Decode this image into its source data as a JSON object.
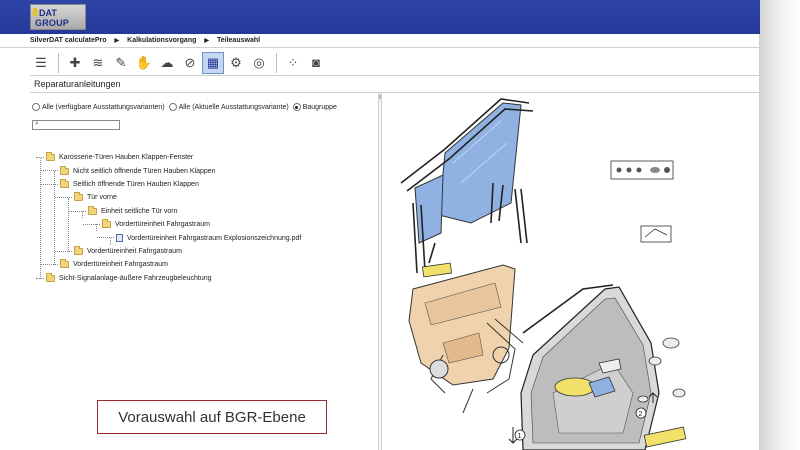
{
  "header": {
    "logo_line1": "DAT",
    "logo_line2": "GROUP"
  },
  "breadcrumb": {
    "items": [
      "SilverDAT calculatePro",
      "Kalkulationsvorgang",
      "Teileauswahl"
    ]
  },
  "toolbar": {
    "buttons": [
      {
        "icon": "menu-icon",
        "glyph": "☰"
      },
      {
        "icon": "add-tool-icon",
        "glyph": "✚"
      },
      {
        "icon": "list-filter-icon",
        "glyph": "≋"
      },
      {
        "icon": "wrench-icon",
        "glyph": "✎"
      },
      {
        "icon": "hand-icon",
        "glyph": "✋"
      },
      {
        "icon": "cloud-icon",
        "glyph": "☁"
      },
      {
        "icon": "no-car-icon",
        "glyph": "⊘"
      },
      {
        "icon": "diagram-icon",
        "glyph": "▦",
        "active": true
      },
      {
        "icon": "engine-icon",
        "glyph": "⚙"
      },
      {
        "icon": "tire-icon",
        "glyph": "◎"
      },
      {
        "icon": "parts-grid-icon",
        "glyph": "⁘"
      },
      {
        "icon": "camera-icon",
        "glyph": "◙"
      }
    ],
    "active_color": "#c6d7ef"
  },
  "section": {
    "title": "Reparaturanleitungen"
  },
  "filter": {
    "options": [
      {
        "label": "Alle (verfügbare Ausstattungsvarianten)",
        "checked": false
      },
      {
        "label": "Alle (Aktuelle Ausstattungsvariante)",
        "checked": false
      },
      {
        "label": "Baugruppe",
        "checked": true
      }
    ],
    "search_value": ""
  },
  "tree": {
    "nodes": [
      {
        "label": "Karosserie-Türen Hauben Klappen-Fenster",
        "level": 0,
        "type": "folder"
      },
      {
        "label": "Nicht seitlich öffnende Türen Hauben Klappen",
        "level": 1,
        "type": "folder"
      },
      {
        "label": "Seitlich öffnende Türen Hauben Klappen",
        "level": 1,
        "type": "folder"
      },
      {
        "label": "Tür vorne",
        "level": 2,
        "type": "folder"
      },
      {
        "label": "Einheit seitliche Tür vorn",
        "level": 3,
        "type": "folder"
      },
      {
        "label": "Vordertüreinheit Fahrgastraum",
        "level": 4,
        "type": "folder"
      },
      {
        "label": "Vordertüreinheit Fahrgastraum Explosionszeichnung.pdf",
        "level": 5,
        "type": "pdf"
      },
      {
        "label": "Vordertüreinheit Fahrgastraum",
        "level": 2,
        "type": "folder"
      },
      {
        "label": "Vordertüreinheit Fahrgastraum",
        "level": 1,
        "type": "folder"
      },
      {
        "label": "Sicht-Signalanlage-äußere Fahrzeugbeleuchtung",
        "level": 0,
        "type": "folder"
      }
    ]
  },
  "callout": {
    "text": "Vorauswahl auf BGR-Ebene"
  },
  "diagram": {
    "markers": [
      "1",
      "2"
    ]
  },
  "colors": {
    "header": "#24399a",
    "callout_border": "#9b2b2b",
    "glass": "#7fa6dc",
    "trim": "#efcfa8",
    "highlight": "#f1e16a"
  }
}
